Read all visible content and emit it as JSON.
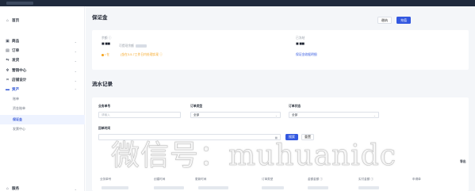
{
  "sidebar": {
    "items": [
      {
        "label": "首页",
        "icon": "home-icon"
      },
      {
        "label": "商品",
        "icon": "goods-icon"
      },
      {
        "label": "订单",
        "icon": "order-icon"
      },
      {
        "label": "发货",
        "icon": "delivery-icon"
      },
      {
        "label": "营销中心",
        "icon": "marketing-icon"
      },
      {
        "label": "店铺设计",
        "icon": "design-icon"
      },
      {
        "label": "资产",
        "icon": "asset-icon"
      },
      {
        "label": "服务",
        "icon": "service-icon"
      }
    ],
    "sub_items": [
      "账单",
      "资金账单",
      "保证金",
      "发票中心"
    ]
  },
  "deposit": {
    "title": "保证金",
    "btn_secondary": "缴纳",
    "btn_primary": "充值",
    "amount_label": "余额 ⓘ",
    "available_label": "可提现余额",
    "warning_prefix": "• 在",
    "warning_text": "(金在3-5-7工作日内处理实现 ⓘ",
    "right_label": "已冻结",
    "right_link": "保证金收据明细"
  },
  "records": {
    "title": "流水记录",
    "filters": {
      "order_no_label": "业务单号",
      "order_no_placeholder": "请输入",
      "order_type_label": "订单类型",
      "order_type_value": "全部",
      "order_status_label": "订单状态",
      "order_status_value": "全部",
      "time_label": "回单时间",
      "search_btn": "搜索",
      "reset_btn": "重置"
    },
    "table_headers": [
      "业务单号",
      "创建时间",
      "更新时间",
      "订单类型",
      "金额金额 ⓘ",
      "实付金额 ⓘ",
      "申请单"
    ],
    "export_label": "导出"
  },
  "watermark": "微信号：muhuanidc"
}
